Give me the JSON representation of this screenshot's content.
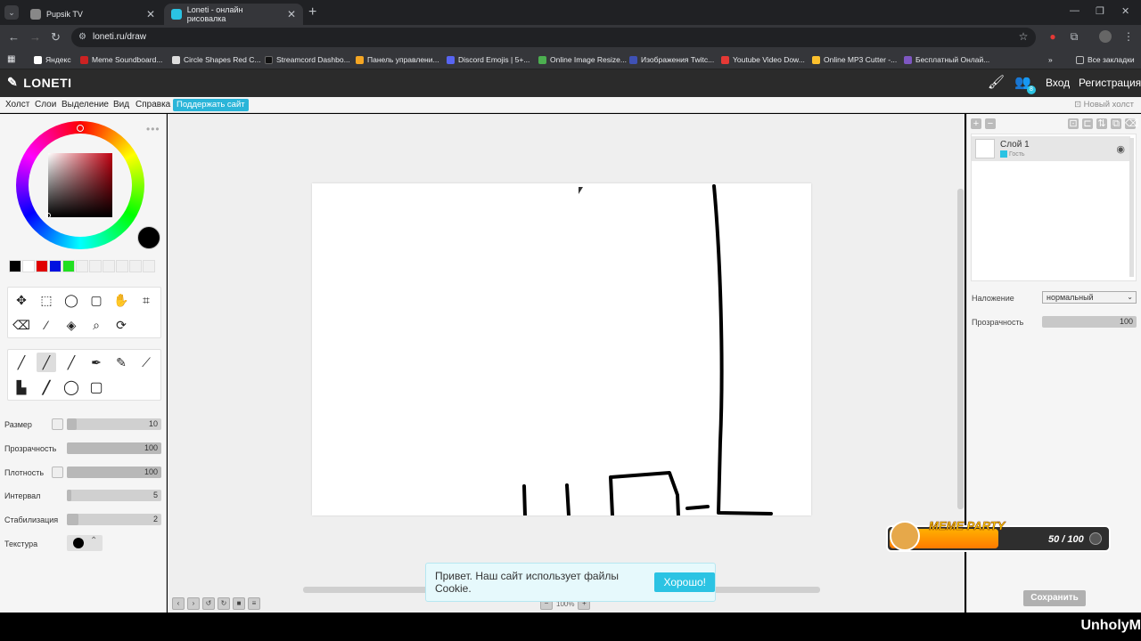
{
  "browser": {
    "tabs": [
      {
        "title": "Pupsik TV",
        "color": "#888888"
      },
      {
        "title": "Loneti - онлайн рисовалка",
        "color": "#2bc3e3"
      }
    ],
    "url": "loneti.ru/draw",
    "bookmarks": [
      {
        "label": "Яндекс",
        "color": "#ffffff"
      },
      {
        "label": "Meme Soundboard...",
        "color": "#cc2222"
      },
      {
        "label": "Circle Shapes Red C...",
        "color": "#dddddd"
      },
      {
        "label": "Streamcord Dashbo...",
        "color": "#111111"
      },
      {
        "label": "Панель управлени...",
        "color": "#f5a623"
      },
      {
        "label": "Discord Emojis | 5+...",
        "color": "#5865f2"
      },
      {
        "label": "Online Image Resize...",
        "color": "#4caf50"
      },
      {
        "label": "Изображения Twitc...",
        "color": "#3f51b5"
      },
      {
        "label": "Youtube Video Dow...",
        "color": "#e53935"
      },
      {
        "label": "Online MP3 Cutter -...",
        "color": "#fbc02d"
      },
      {
        "label": "Бесплатный Онлай...",
        "color": "#7e57c2"
      }
    ],
    "all_bookmarks": "Все закладки"
  },
  "app": {
    "logo": "LONETI",
    "login": "Вход",
    "register": "Регистрация",
    "badge": "8"
  },
  "menu": {
    "items": [
      "Холст",
      "Слои",
      "Выделение",
      "Вид",
      "Справка"
    ],
    "support": "Поддержать сайт",
    "new_canvas": "Новый холст"
  },
  "palette": {
    "current": "#000000",
    "swatches": [
      "#000000",
      "#ffffff",
      "#e00000",
      "#0010e0",
      "#20e020",
      "#f0f0f0",
      "#f0f0f0",
      "#f0f0f0",
      "#f0f0f0",
      "#f0f0f0",
      "#f0f0f0"
    ]
  },
  "params": [
    {
      "label": "Размер",
      "value": "10",
      "fill": 0.1,
      "check": true
    },
    {
      "label": "Прозрачность",
      "value": "100",
      "fill": 1,
      "check": false
    },
    {
      "label": "Плотность",
      "value": "100",
      "fill": 1,
      "check": true
    },
    {
      "label": "Интервал",
      "value": "5",
      "fill": 0.05,
      "check": false
    },
    {
      "label": "Стабилизация",
      "value": "2",
      "fill": 0.12,
      "check": false
    }
  ],
  "texture_label": "Текстура",
  "zoom": "100%",
  "cookie": {
    "text": "Привет. Наш сайт использует файлы Cookie.",
    "button": "Хорошо!"
  },
  "layers": {
    "items": [
      {
        "name": "Слой 1",
        "owner": "Гость"
      }
    ],
    "blend_label": "Наложение",
    "blend_value": "нормальный",
    "opacity_label": "Прозрачность",
    "opacity_value": "100",
    "save": "Сохранить"
  },
  "overlay": {
    "title": "MEME PARTY",
    "count": "50 / 100",
    "progress": 0.5
  },
  "watermark": "UnholyM"
}
